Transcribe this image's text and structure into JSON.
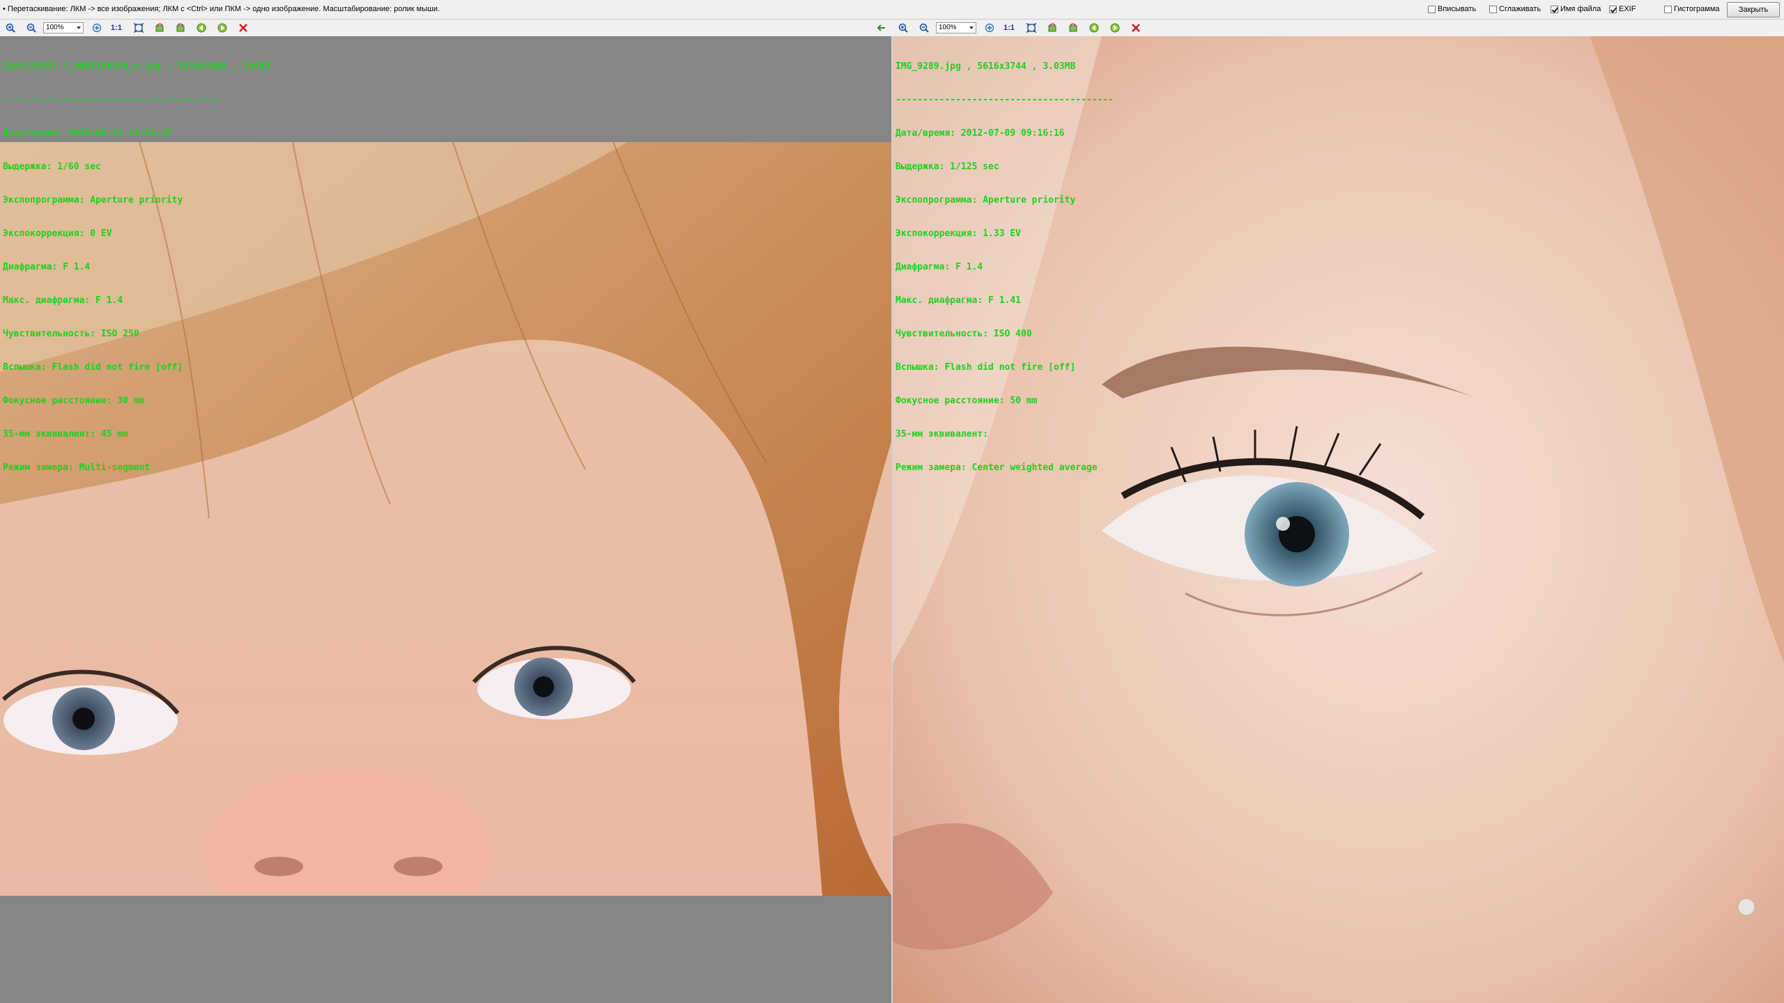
{
  "hint": "• Перетаскивание: ЛКМ -> все изображения; ЛКМ с <Ctrl> или ПКМ -> одно изображение. Масштабирование: ролик мыши.",
  "options": [
    {
      "label": "Вписывать",
      "checked": false
    },
    {
      "label": "Сглаживать",
      "checked": false
    },
    {
      "label": "Имя файла",
      "checked": true
    },
    {
      "label": "EXIF",
      "checked": true
    },
    {
      "label": "Гистограмма",
      "checked": false
    }
  ],
  "close_label": "Закрыть",
  "toolbar": {
    "zoom": "100%",
    "one_to_one": "1:1"
  },
  "left": {
    "header": "2804178031 7_6085104206_o.jpg , 1920x1080 , 304KB",
    "sep": "----------------------------------------",
    "lines": [
      "Дата/время: 2018-05-16 18:26:47",
      "Выдержка: 1/60 sec",
      "Экспопрограмма: Aperture priority",
      "Экспокоррекция: 0 EV",
      "Диафрагма: F 1.4",
      "Макс. диафрагма: F 1.4",
      "Чувствительность: ISO 250",
      "Вспышка: Flash did not fire [off]",
      "Фокусное расстояние: 30 mm",
      "35-мм эквивалент: 45 mm",
      "Режим замера: Multi-segment"
    ]
  },
  "right": {
    "header": "IMG_9289.jpg , 5616x3744 , 3.03MB",
    "sep": "----------------------------------------",
    "lines": [
      "Дата/время: 2012-07-09 09:16:16",
      "Выдержка: 1/125 sec",
      "Экспопрограмма: Aperture priority",
      "Экспокоррекция: 1.33 EV",
      "Диафрагма: F 1.4",
      "Макс. диафрагма: F 1.41",
      "Чувствительность: ISO 400",
      "Вспышка: Flash did not fire [off]",
      "Фокусное расстояние: 50 mm",
      "35-мм эквивалент:",
      "Режим замера: Center weighted average"
    ]
  },
  "colors": {
    "exif_text": "#1ed11e",
    "pane_bg": "#858585"
  }
}
